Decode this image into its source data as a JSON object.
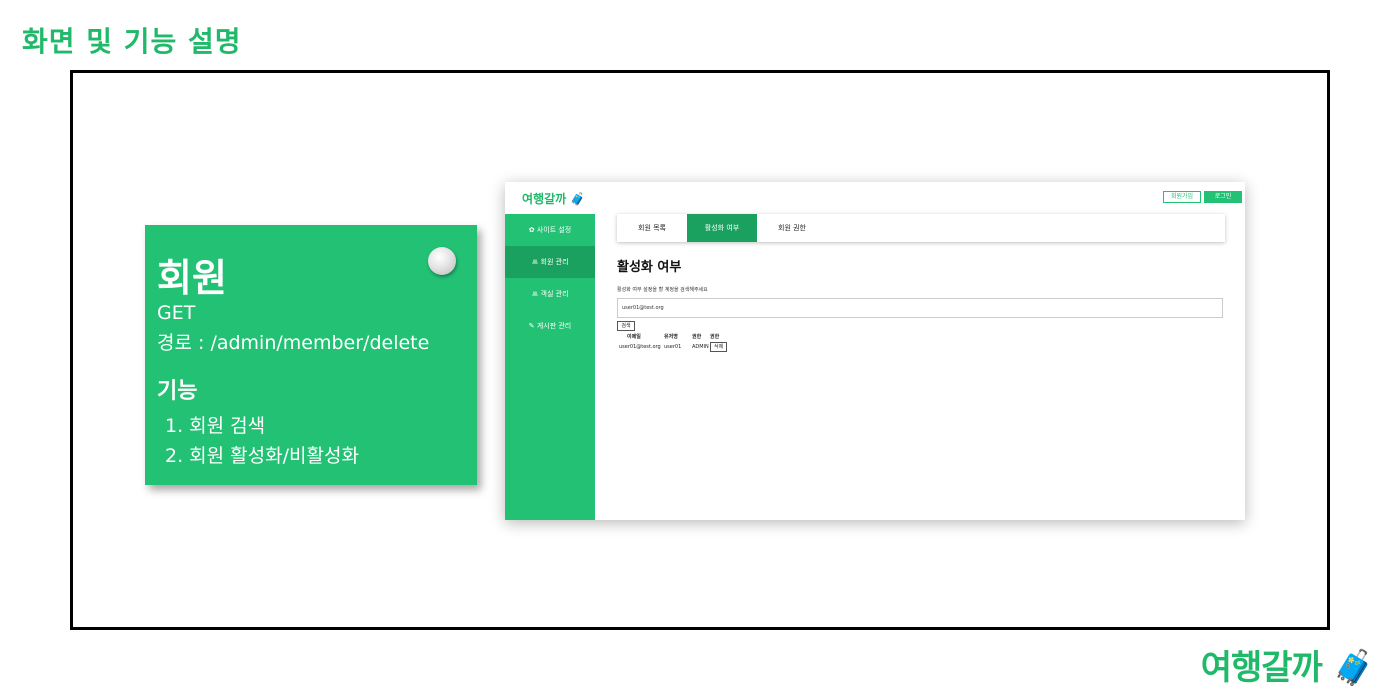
{
  "slide": {
    "title": "화면 및 기능 설명",
    "brand": "여행갈까 🧳"
  },
  "note": {
    "title": "회원",
    "method": "GET",
    "route": "경로 : /admin/member/delete",
    "functions_title": "기능",
    "functions": [
      "1. 회원 검색",
      "2. 회원 활성화/비활성화"
    ]
  },
  "shot": {
    "logo": "여행갈까 🧳",
    "join_label": "회원가입",
    "login_label": "로그인",
    "sidebar": [
      {
        "label": "✿ 사이트 설정",
        "active": false
      },
      {
        "label": "ꔛ 회원 관리",
        "active": true
      },
      {
        "label": "ꔛ 객실 관리",
        "active": false
      },
      {
        "label": "✎ 게시판 관리",
        "active": false
      }
    ],
    "tabs": [
      {
        "label": "회원 목록",
        "active": false
      },
      {
        "label": "활성화 여부",
        "active": true
      },
      {
        "label": "회원 권한",
        "active": false
      }
    ],
    "heading": "활성화 여부",
    "hint": "활성화 여부 설정을 할 계정을 검색해주세요",
    "search_value": "user01@test.org",
    "search_button": "검색",
    "table": {
      "headers": [
        "이메일",
        "유저명",
        "권한",
        "권한"
      ],
      "rows": [
        [
          "user01@test.org",
          "user01",
          "ADMIN",
          "삭제"
        ]
      ]
    },
    "colors": {
      "green": "#22c174",
      "dark_green": "#1aa05f"
    }
  }
}
